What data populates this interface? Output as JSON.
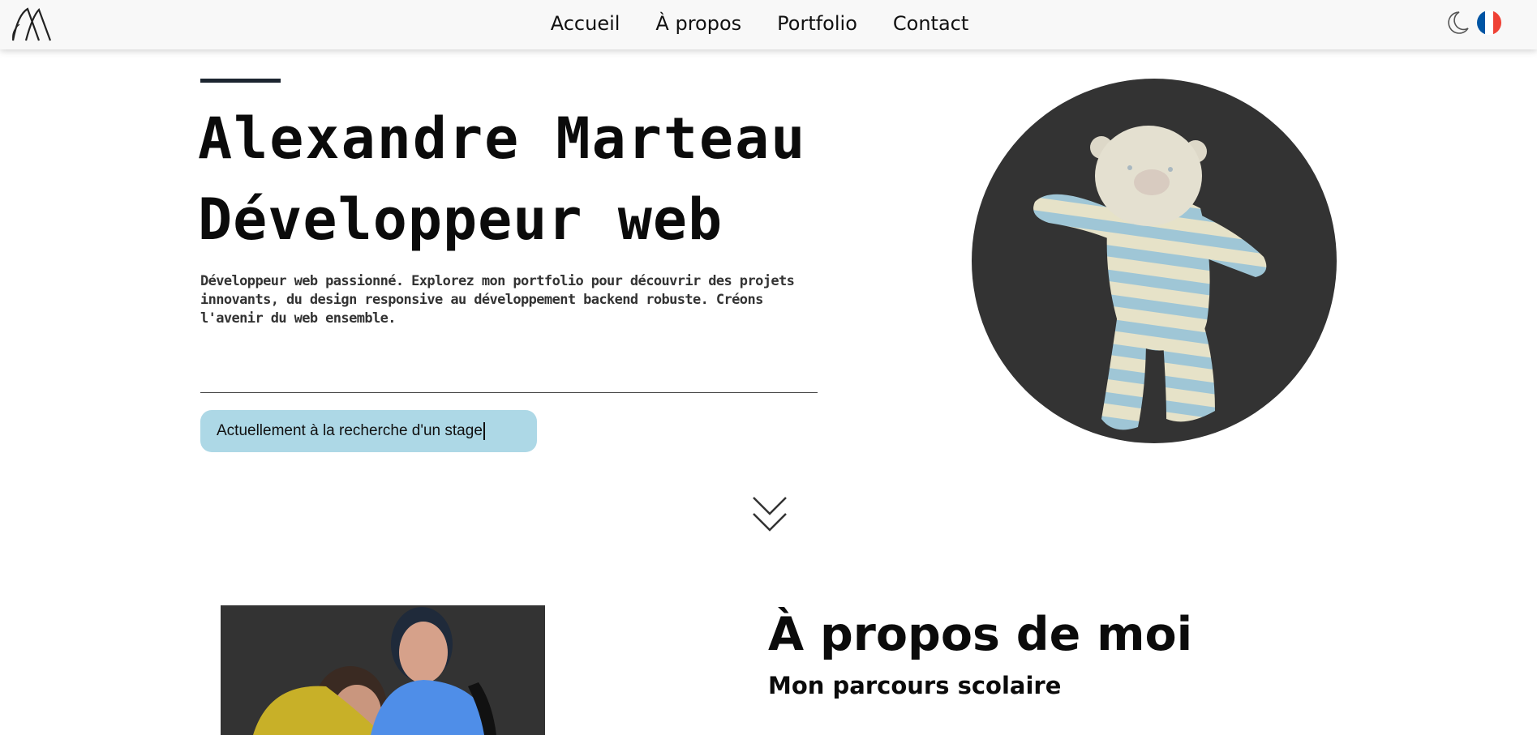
{
  "nav": {
    "items": [
      "Accueil",
      "À propos",
      "Portfolio",
      "Contact"
    ]
  },
  "header": {
    "logo_icon": "monogram-logo",
    "theme_icon": "moon-icon",
    "language_icon": "french-flag-icon",
    "flag_colors": [
      "#0055a4",
      "#ffffff",
      "#ef4135"
    ]
  },
  "hero": {
    "name": "Alexandre Marteau",
    "role": "Développeur web",
    "description": "Développeur web passionné. Explorez mon portfolio pour découvrir des projets innovants, du design responsive au développement backend robuste. Créons l'avenir du web ensemble.",
    "status": "Actuellement à la recherche d'un stage",
    "status_color": "#add8e6",
    "avatar_bg": "#333333",
    "scroll_icon": "double-chevron-down-icon"
  },
  "about": {
    "title": "À propos de moi",
    "subtitle": "Mon parcours scolaire"
  }
}
